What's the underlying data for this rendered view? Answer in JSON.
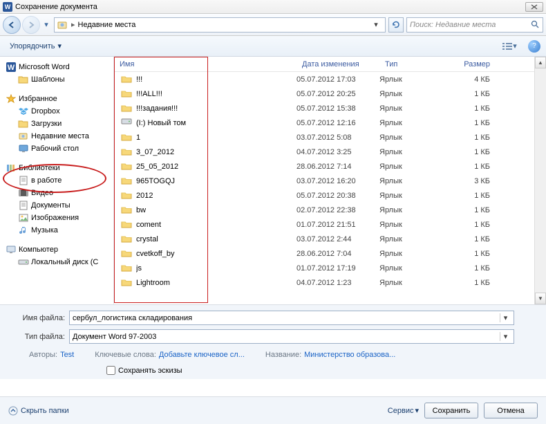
{
  "title": "Сохранение документа",
  "nav": {
    "breadcrumb": "Недавние места"
  },
  "search": {
    "placeholder": "Поиск: Недавние места"
  },
  "organize": "Упорядочить",
  "sidebar": {
    "word": "Microsoft Word",
    "templates": "Шаблоны",
    "fav": "Избранное",
    "dropbox": "Dropbox",
    "downloads": "Загрузки",
    "recent": "Недавние места",
    "desktop": "Рабочий стол",
    "libs": "Библиотеки",
    "work": "в работе",
    "video": "Видео",
    "docs": "Документы",
    "images": "Изображения",
    "music": "Музыка",
    "computer": "Компьютер",
    "cdrive": "Локальный диск (C"
  },
  "cols": {
    "name": "Имя",
    "date": "Дата изменения",
    "type": "Тип",
    "size": "Размер"
  },
  "files": [
    {
      "icon": "folder",
      "name": "!!!",
      "date": "05.07.2012 17:03",
      "type": "Ярлык",
      "size": "4 КБ"
    },
    {
      "icon": "folder",
      "name": "!!!ALL!!!",
      "date": "05.07.2012 20:25",
      "type": "Ярлык",
      "size": "1 КБ"
    },
    {
      "icon": "folder",
      "name": "!!!задания!!!",
      "date": "05.07.2012 15:38",
      "type": "Ярлык",
      "size": "1 КБ"
    },
    {
      "icon": "drive",
      "name": "(I:) Новый том",
      "date": "05.07.2012 12:16",
      "type": "Ярлык",
      "size": "1 КБ"
    },
    {
      "icon": "folder",
      "name": "1",
      "date": "03.07.2012 5:08",
      "type": "Ярлык",
      "size": "1 КБ"
    },
    {
      "icon": "folder",
      "name": "3_07_2012",
      "date": "04.07.2012 3:25",
      "type": "Ярлык",
      "size": "1 КБ"
    },
    {
      "icon": "folder",
      "name": "25_05_2012",
      "date": "28.06.2012 7:14",
      "type": "Ярлык",
      "size": "1 КБ"
    },
    {
      "icon": "folder",
      "name": "965TOGQJ",
      "date": "03.07.2012 16:20",
      "type": "Ярлык",
      "size": "3 КБ"
    },
    {
      "icon": "folder",
      "name": "2012",
      "date": "05.07.2012 20:38",
      "type": "Ярлык",
      "size": "1 КБ"
    },
    {
      "icon": "folder",
      "name": "bw",
      "date": "02.07.2012 22:38",
      "type": "Ярлык",
      "size": "1 КБ"
    },
    {
      "icon": "folder",
      "name": "coment",
      "date": "01.07.2012 21:51",
      "type": "Ярлык",
      "size": "1 КБ"
    },
    {
      "icon": "folder",
      "name": "crystal",
      "date": "03.07.2012 2:44",
      "type": "Ярлык",
      "size": "1 КБ"
    },
    {
      "icon": "folder",
      "name": "cvetkoff_by",
      "date": "28.06.2012 7:04",
      "type": "Ярлык",
      "size": "1 КБ"
    },
    {
      "icon": "folder",
      "name": "js",
      "date": "01.07.2012 17:19",
      "type": "Ярлык",
      "size": "1 КБ"
    },
    {
      "icon": "folder",
      "name": "Lightroom",
      "date": "04.07.2012 1:23",
      "type": "Ярлык",
      "size": "1 КБ"
    }
  ],
  "fname_label": "Имя файла:",
  "ftype_label": "Тип файла:",
  "fname_value": "сербул_логистика складирования",
  "ftype_value": "Документ Word 97-2003",
  "meta": {
    "authors_lbl": "Авторы:",
    "authors_val": "Test",
    "keys_lbl": "Ключевые слова:",
    "keys_val": "Добавьте ключевое сл...",
    "title_lbl": "Название:",
    "title_val": "Министерство образова..."
  },
  "thumb_chk": "Сохранять эскизы",
  "hide_folders": "Скрыть папки",
  "tools": "Сервис",
  "save": "Сохранить",
  "cancel": "Отмена"
}
